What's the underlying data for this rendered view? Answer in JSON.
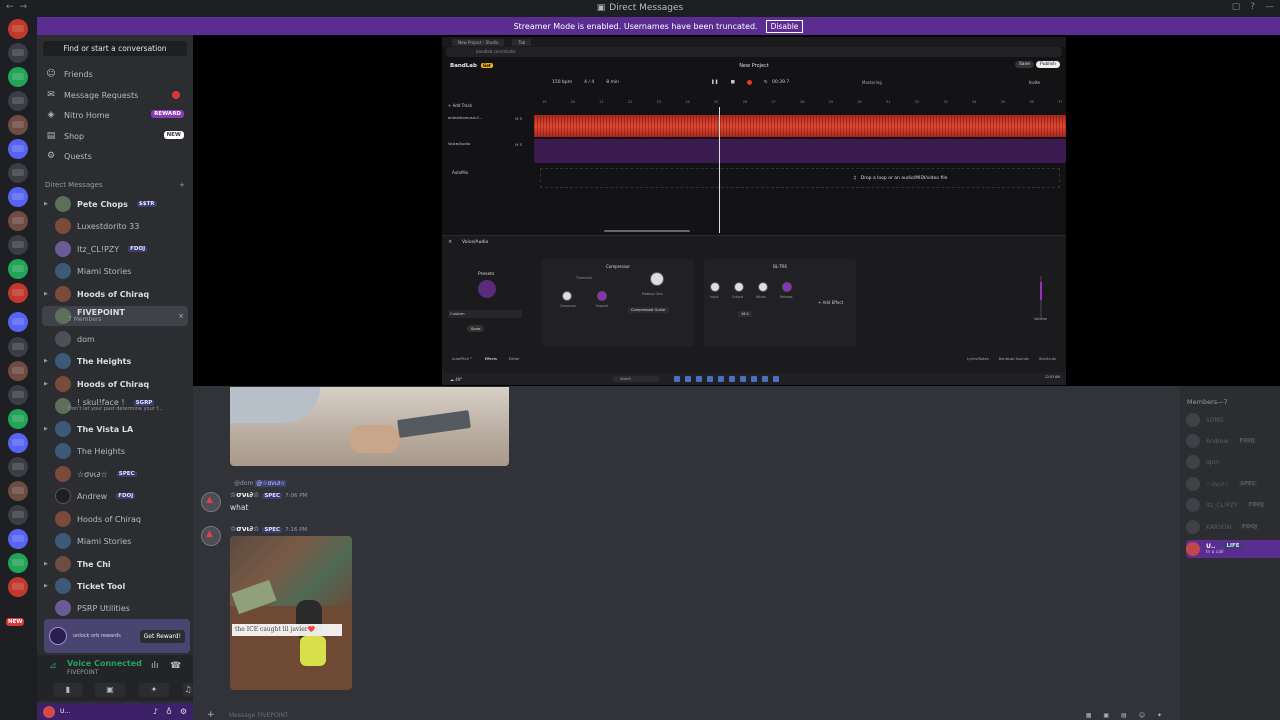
{
  "titlebar": {
    "title": "Direct Messages"
  },
  "banner": {
    "text": "Streamer Mode is enabled. Usernames have been truncated.",
    "button": "Disable"
  },
  "sidebar": {
    "search_placeholder": "Find or start a conversation",
    "nav": [
      {
        "label": "Friends",
        "icon": "friends-icon"
      },
      {
        "label": "Message Requests",
        "icon": "mail-icon"
      },
      {
        "label": "Nitro Home",
        "icon": "nitro-icon",
        "tag": "REWARD"
      },
      {
        "label": "Shop",
        "icon": "shop-icon",
        "tag": "NEW"
      },
      {
        "label": "Quests",
        "icon": "quests-icon"
      }
    ],
    "dm_header": "Direct Messages",
    "dms": [
      {
        "name": "Pete Chops",
        "tag": "$$TR"
      },
      {
        "name": "Luxestdorito 33"
      },
      {
        "name": "Itz_CL!PZY",
        "tag": "FDOJ"
      },
      {
        "name": "Miami Stories"
      },
      {
        "name": "Hoods of Chiraq"
      },
      {
        "name": "FIVEPOINT",
        "sub": "7 Members"
      },
      {
        "name": "dom"
      },
      {
        "name": "The Heights"
      },
      {
        "name": "Hoods of Chiraq"
      },
      {
        "name": "! skul!face !",
        "tag": "SGRP",
        "sub": "Don't let your past determine your f..."
      },
      {
        "name": "The Vista LA"
      },
      {
        "name": "The Heights"
      },
      {
        "name": "☆σνι∂☆",
        "tag": "SPEC"
      },
      {
        "name": "Andrew",
        "tag": "FDOJ"
      },
      {
        "name": "Hoods of Chiraq"
      },
      {
        "name": "Miami Stories"
      },
      {
        "name": "The Chi"
      },
      {
        "name": "Ticket Tool"
      },
      {
        "name": "PSRP Utilities"
      }
    ],
    "promo": {
      "text": "unlock orb rewards",
      "button": "Get Reward!"
    },
    "voice": {
      "status": "Voice Connected",
      "channel": "FIVEPOINT"
    },
    "rail_new": "NEW"
  },
  "bandlab": {
    "logo": "BandLab",
    "upgrade": "Get",
    "project": "New Project",
    "save": "Save",
    "publish": "Publish",
    "bpm": "150 bpm",
    "meter": "4 / 4",
    "key": "8 min",
    "time": "00:39.7",
    "mastering": "Mastering",
    "invite": "Invite",
    "add_track": "+ Add Track",
    "track1": "ahrksthomusic-f...",
    "track2": "Voice/Audio",
    "autotune": "AutoMix",
    "drop": "Drop a loop or an audio/MIDI/video file",
    "ruler": [
      "19",
      "20",
      "21",
      "22",
      "23",
      "24",
      "25",
      "26",
      "27",
      "28",
      "29",
      "30",
      "31",
      "32",
      "33",
      "34",
      "35",
      "36",
      "37"
    ],
    "panel_title": "Voice/Audio",
    "presets": "Presets",
    "custom": "Custom",
    "psave": "Save",
    "comp": {
      "title": "Compressor",
      "k1": "Threshold",
      "k2": "Makeup Gain",
      "k3": "Compress",
      "k4": "Expand",
      "sel": "Compressed Guitar"
    },
    "bl": {
      "title": "BL-TR6",
      "k1": "Input",
      "k2": "Output",
      "k3": "Attack",
      "k4": "Release",
      "sel": "16:1"
    },
    "add_effect": "Add Effect",
    "volume": "Volume",
    "bottom": [
      "AutoPitch™",
      "Effects",
      "Editor"
    ],
    "bottom_right": [
      "Lyrics/Notes",
      "BandLab Sounds",
      "Shortcuts"
    ],
    "win_search": "Search",
    "clock": "12:53 AM"
  },
  "messages": {
    "reply_user": "@dom",
    "reply_mention": "@☆σνι∂☆",
    "m1": {
      "author": "☆σνι∂☆",
      "tag": "SPEC",
      "time": "7:06 PM",
      "text": "what"
    },
    "m2": {
      "author": "☆σνι∂☆",
      "tag": "SPEC",
      "time": "7:16 PM"
    },
    "caption": "the ICE caught lil javier❤️"
  },
  "chat": {
    "placeholder": "Message FIVEPOINT"
  },
  "members": {
    "header": "Members—7",
    "list": [
      {
        "name": "SONG"
      },
      {
        "name": "Andrew",
        "tag": "FDOJ"
      },
      {
        "name": "Iqon"
      },
      {
        "name": "☆σνι∂☆",
        "tag": "SPEC"
      },
      {
        "name": "Itz_CL!PZY",
        "tag": "FDOJ"
      },
      {
        "name": "KARSON",
        "tag": "FDOJ"
      },
      {
        "name": "U..",
        "tag": "LIFE",
        "sub": "In a call"
      }
    ]
  }
}
